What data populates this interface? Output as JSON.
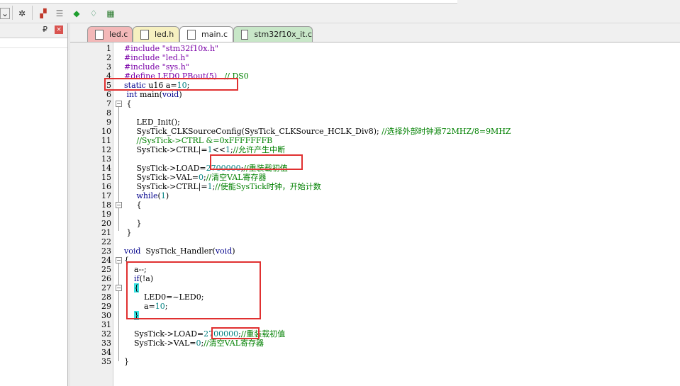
{
  "tabs": [
    {
      "label": "led.c",
      "active": false,
      "color": "#f3b8b8"
    },
    {
      "label": "led.h",
      "active": false,
      "color": "#f6f0c0"
    },
    {
      "label": "main.c",
      "active": true,
      "color": "#ffffff"
    },
    {
      "label": "stm32f10x_it.c",
      "active": false,
      "color": "#c8e7c8"
    }
  ],
  "toolbar": {
    "icons": [
      "dropdown-icon",
      "magic-wand-icon",
      "build-icon",
      "rebuild-icon",
      "diamond-green-icon",
      "gem-icon",
      "flash-icon"
    ]
  },
  "panel": {
    "pin": "₽",
    "close": "×"
  },
  "code_lines": [
    {
      "n": "1",
      "segs": [
        [
          "pre",
          "#include "
        ],
        [
          "str",
          "\"stm32f10x.h\""
        ]
      ]
    },
    {
      "n": "2",
      "segs": [
        [
          "pre",
          "#include "
        ],
        [
          "str",
          "\"led.h\""
        ]
      ]
    },
    {
      "n": "3",
      "segs": [
        [
          "pre",
          "#include "
        ],
        [
          "str",
          "\"sys.h\""
        ]
      ]
    },
    {
      "n": "4",
      "segs": [
        [
          "pre",
          "#define LED0 PBout(5)"
        ],
        [
          "plain",
          "   "
        ],
        [
          "com",
          "// DS0"
        ]
      ]
    },
    {
      "n": "5",
      "segs": [
        [
          "kw",
          "static"
        ],
        [
          "plain",
          " u16 a="
        ],
        [
          "num",
          "10"
        ],
        [
          "plain",
          ";"
        ]
      ]
    },
    {
      "n": "6",
      "segs": [
        [
          "plain",
          " "
        ],
        [
          "kw",
          "int"
        ],
        [
          "plain",
          " main("
        ],
        [
          "kw",
          "void"
        ],
        [
          "plain",
          ")"
        ]
      ]
    },
    {
      "n": "7",
      "segs": [
        [
          "plain",
          " {"
        ]
      ],
      "fold": "start"
    },
    {
      "n": "8",
      "segs": []
    },
    {
      "n": "9",
      "segs": [
        [
          "plain",
          "     LED_Init();"
        ]
      ]
    },
    {
      "n": "10",
      "segs": [
        [
          "plain",
          "     SysTick_CLKSourceConfig(SysTick_CLKSource_HCLK_Div8); "
        ],
        [
          "com",
          "//选择外部时钟源72MHZ/8=9MHZ"
        ]
      ]
    },
    {
      "n": "11",
      "segs": [
        [
          "plain",
          "     "
        ],
        [
          "com",
          "//SysTick->CTRL &=0xFFFFFFFB"
        ]
      ]
    },
    {
      "n": "12",
      "segs": [
        [
          "plain",
          "     SysTick->CTRL|="
        ],
        [
          "num",
          "1"
        ],
        [
          "plain",
          "<<"
        ],
        [
          "num",
          "1"
        ],
        [
          "plain",
          ";"
        ],
        [
          "com",
          "//允许产生中断"
        ]
      ]
    },
    {
      "n": "13",
      "segs": []
    },
    {
      "n": "14",
      "segs": [
        [
          "plain",
          "     SysTick->LOAD="
        ],
        [
          "num",
          "2700000"
        ],
        [
          "plain",
          ";"
        ],
        [
          "com",
          "//重装载初值"
        ]
      ]
    },
    {
      "n": "15",
      "segs": [
        [
          "plain",
          "     SysTick->VAL="
        ],
        [
          "num",
          "0"
        ],
        [
          "plain",
          ";"
        ],
        [
          "com",
          "//清空VAL寄存器"
        ]
      ]
    },
    {
      "n": "16",
      "segs": [
        [
          "plain",
          "     SysTick->CTRL|="
        ],
        [
          "num",
          "1"
        ],
        [
          "plain",
          ";"
        ],
        [
          "com",
          "//使能SysTick时钟，开始计数"
        ]
      ]
    },
    {
      "n": "17",
      "segs": [
        [
          "plain",
          "     "
        ],
        [
          "kw",
          "while"
        ],
        [
          "plain",
          "("
        ],
        [
          "num",
          "1"
        ],
        [
          "plain",
          ")"
        ]
      ]
    },
    {
      "n": "18",
      "segs": [
        [
          "plain",
          "     {"
        ]
      ],
      "fold": "start"
    },
    {
      "n": "19",
      "segs": []
    },
    {
      "n": "20",
      "segs": [
        [
          "plain",
          "     }"
        ]
      ]
    },
    {
      "n": "21",
      "segs": [
        [
          "plain",
          " }"
        ]
      ]
    },
    {
      "n": "22",
      "segs": []
    },
    {
      "n": "23",
      "segs": [
        [
          "kw",
          "void"
        ],
        [
          "plain",
          "  SysTick_Handler("
        ],
        [
          "kw",
          "void"
        ],
        [
          "plain",
          ")"
        ]
      ]
    },
    {
      "n": "24",
      "segs": [
        [
          "plain",
          "{"
        ]
      ],
      "fold": "start"
    },
    {
      "n": "25",
      "segs": [
        [
          "plain",
          "    a--;"
        ]
      ]
    },
    {
      "n": "26",
      "segs": [
        [
          "plain",
          "    "
        ],
        [
          "kw",
          "if"
        ],
        [
          "plain",
          "(!a)"
        ]
      ]
    },
    {
      "n": "27",
      "segs": [
        [
          "plain",
          "    "
        ],
        [
          "brace",
          "{"
        ]
      ],
      "fold": "start"
    },
    {
      "n": "28",
      "segs": [
        [
          "plain",
          "        LED0=~LED0;"
        ]
      ]
    },
    {
      "n": "29",
      "segs": [
        [
          "plain",
          "        a="
        ],
        [
          "num",
          "10"
        ],
        [
          "plain",
          ";"
        ]
      ]
    },
    {
      "n": "30",
      "segs": [
        [
          "plain",
          "    "
        ],
        [
          "brace",
          "}"
        ]
      ]
    },
    {
      "n": "31",
      "segs": []
    },
    {
      "n": "32",
      "segs": [
        [
          "plain",
          "    SysTick->LOAD="
        ],
        [
          "num",
          "2700000"
        ],
        [
          "plain",
          ";"
        ],
        [
          "com",
          "//重装载初值"
        ]
      ]
    },
    {
      "n": "33",
      "segs": [
        [
          "plain",
          "    SysTick->VAL="
        ],
        [
          "num",
          "0"
        ],
        [
          "plain",
          ";"
        ],
        [
          "com",
          "//清空VAL寄存器"
        ]
      ]
    },
    {
      "n": "34",
      "segs": []
    },
    {
      "n": "35",
      "segs": [
        [
          "plain",
          "}"
        ]
      ]
    }
  ]
}
